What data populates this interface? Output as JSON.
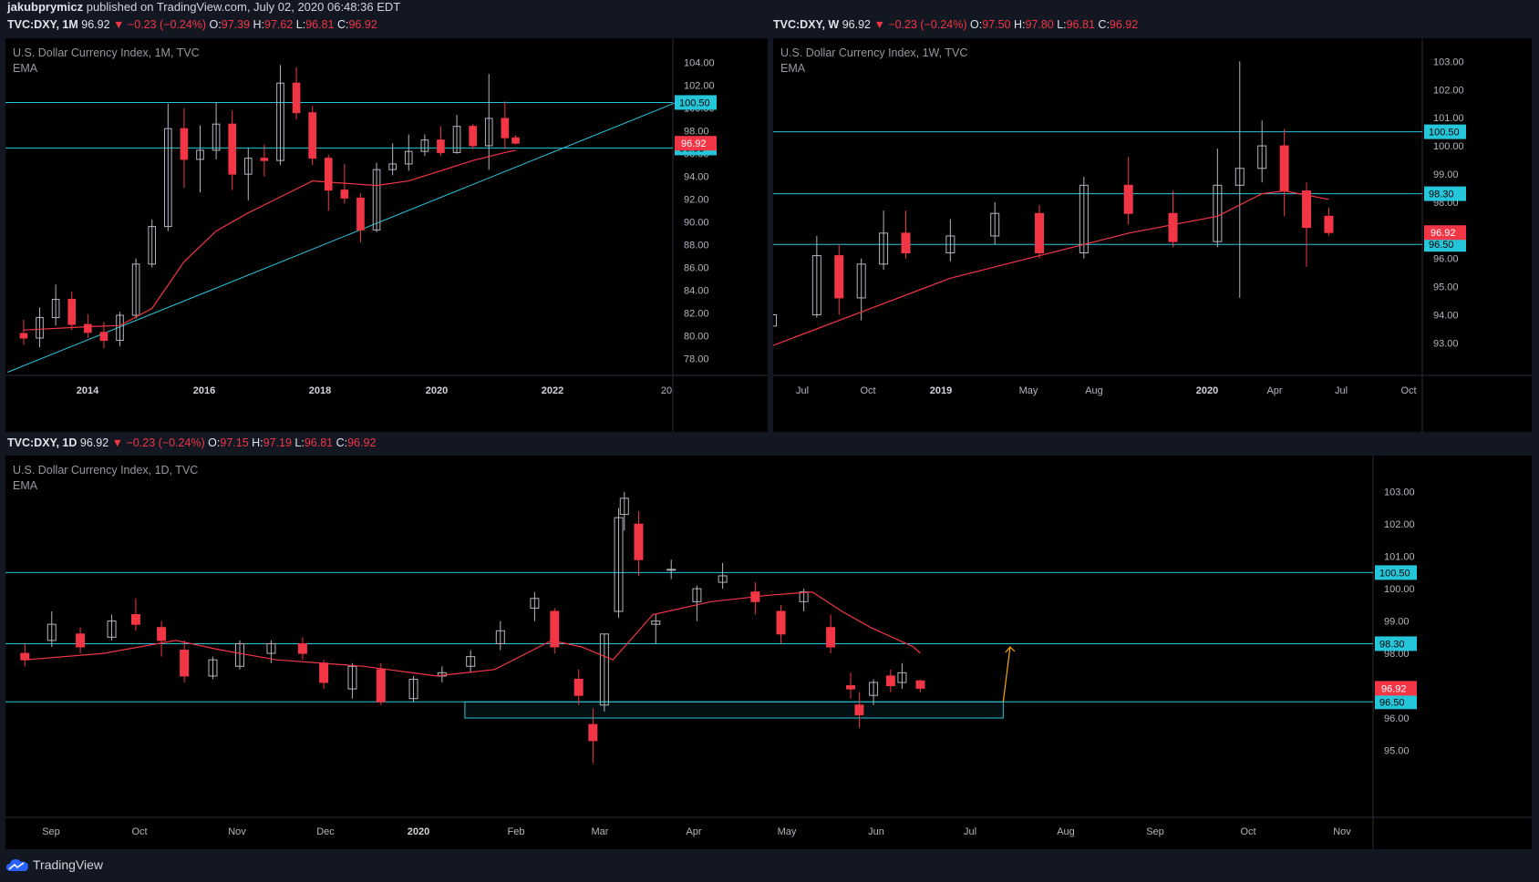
{
  "publish": {
    "author": "jakubprymicz",
    "text": "published on TradingView.com, July 02, 2020 06:48:36 EDT"
  },
  "headers": [
    {
      "sym": "TVC:DXY, 1M",
      "price": "96.92",
      "chg": "−0.23 (−0.24%)",
      "o": "97.39",
      "h": "97.62",
      "l": "96.81",
      "c": "96.92"
    },
    {
      "sym": "TVC:DXY, W",
      "price": "96.92",
      "chg": "−0.23 (−0.24%)",
      "o": "97.50",
      "h": "97.80",
      "l": "96.81",
      "c": "96.92"
    },
    {
      "sym": "TVC:DXY, 1D",
      "price": "96.92",
      "chg": "−0.23 (−0.24%)",
      "o": "97.15",
      "h": "97.19",
      "l": "96.81",
      "c": "96.92"
    }
  ],
  "colors": {
    "bg": "#000000",
    "chrome": "#131722",
    "up": "#b2b5be",
    "down": "#f23645",
    "ema": "#f23645",
    "level": "#26c6da",
    "target_arrow": "#f7a600"
  },
  "chart_data": [
    {
      "type": "candlestick",
      "title": "U.S. Dollar Currency Index, 1M, TVC",
      "indicator": "EMA",
      "yticks": [
        "104.00",
        "102.00",
        "100.00",
        "98.00",
        "96.00",
        "94.00",
        "92.00",
        "90.00",
        "88.00",
        "86.00",
        "84.00",
        "82.00",
        "80.00",
        "78.00"
      ],
      "xticks": [
        "2014",
        "2016",
        "2018",
        "2020",
        "2022",
        "20"
      ],
      "ylim": [
        77,
        105.5
      ],
      "levels": [
        100.5,
        96.5
      ],
      "level_labels": [
        "100.50",
        "96.50"
      ],
      "last_price": "96.92",
      "trendline": {
        "from": [
          "2012-08",
          76.8
        ],
        "to": [
          "2023-01",
          100.5
        ]
      },
      "series": [
        {
          "t": "2012-11",
          "o": 80.2,
          "h": 81.4,
          "l": 79.2,
          "c": 79.8
        },
        {
          "t": "2013-02",
          "o": 79.8,
          "h": 82.5,
          "l": 79.0,
          "c": 81.6
        },
        {
          "t": "2013-05",
          "o": 81.6,
          "h": 84.5,
          "l": 80.9,
          "c": 83.2
        },
        {
          "t": "2013-08",
          "o": 83.2,
          "h": 83.9,
          "l": 80.5,
          "c": 81.0
        },
        {
          "t": "2013-11",
          "o": 81.0,
          "h": 81.9,
          "l": 79.8,
          "c": 80.3
        },
        {
          "t": "2014-02",
          "o": 80.3,
          "h": 81.2,
          "l": 78.9,
          "c": 79.6
        },
        {
          "t": "2014-05",
          "o": 79.6,
          "h": 82.1,
          "l": 79.1,
          "c": 81.8
        },
        {
          "t": "2014-08",
          "o": 81.8,
          "h": 86.8,
          "l": 81.5,
          "c": 86.3
        },
        {
          "t": "2014-11",
          "o": 86.3,
          "h": 90.2,
          "l": 86.0,
          "c": 89.6
        },
        {
          "t": "2015-02",
          "o": 89.6,
          "h": 100.4,
          "l": 89.2,
          "c": 98.2
        },
        {
          "t": "2015-05",
          "o": 98.2,
          "h": 100.0,
          "l": 93.0,
          "c": 95.5
        },
        {
          "t": "2015-08",
          "o": 95.5,
          "h": 98.5,
          "l": 92.6,
          "c": 96.3
        },
        {
          "t": "2015-11",
          "o": 96.3,
          "h": 100.5,
          "l": 95.5,
          "c": 98.6
        },
        {
          "t": "2016-02",
          "o": 98.6,
          "h": 99.8,
          "l": 92.8,
          "c": 94.2
        },
        {
          "t": "2016-05",
          "o": 94.2,
          "h": 96.5,
          "l": 91.9,
          "c": 95.6
        },
        {
          "t": "2016-08",
          "o": 95.6,
          "h": 96.8,
          "l": 94.0,
          "c": 95.4
        },
        {
          "t": "2016-11",
          "o": 95.4,
          "h": 103.8,
          "l": 95.0,
          "c": 102.2
        },
        {
          "t": "2017-02",
          "o": 102.2,
          "h": 103.6,
          "l": 99.0,
          "c": 99.6
        },
        {
          "t": "2017-05",
          "o": 99.6,
          "h": 100.2,
          "l": 95.0,
          "c": 95.6
        },
        {
          "t": "2017-08",
          "o": 95.6,
          "h": 95.9,
          "l": 91.0,
          "c": 92.8
        },
        {
          "t": "2017-11",
          "o": 92.8,
          "h": 95.1,
          "l": 91.6,
          "c": 92.1
        },
        {
          "t": "2018-02",
          "o": 92.1,
          "h": 92.5,
          "l": 88.2,
          "c": 89.3
        },
        {
          "t": "2018-05",
          "o": 89.3,
          "h": 95.2,
          "l": 89.1,
          "c": 94.6
        },
        {
          "t": "2018-08",
          "o": 94.6,
          "h": 96.9,
          "l": 94.1,
          "c": 95.1
        },
        {
          "t": "2018-11",
          "o": 95.1,
          "h": 97.7,
          "l": 94.5,
          "c": 96.2
        },
        {
          "t": "2019-02",
          "o": 96.2,
          "h": 97.7,
          "l": 95.8,
          "c": 97.2
        },
        {
          "t": "2019-05",
          "o": 97.2,
          "h": 98.4,
          "l": 95.8,
          "c": 96.1
        },
        {
          "t": "2019-08",
          "o": 96.1,
          "h": 99.4,
          "l": 96.0,
          "c": 98.4
        },
        {
          "t": "2019-11",
          "o": 98.4,
          "h": 98.6,
          "l": 96.4,
          "c": 96.7
        },
        {
          "t": "2020-02",
          "o": 96.7,
          "h": 103.0,
          "l": 94.6,
          "c": 99.1
        },
        {
          "t": "2020-05",
          "o": 99.1,
          "h": 100.6,
          "l": 96.4,
          "c": 97.4
        },
        {
          "t": "2020-07",
          "o": 97.39,
          "h": 97.62,
          "l": 96.81,
          "c": 96.92
        }
      ],
      "ema": [
        [
          "2012-11",
          80.5
        ],
        [
          "2013-11",
          80.8
        ],
        [
          "2014-05",
          80.9
        ],
        [
          "2014-11",
          82.4
        ],
        [
          "2015-05",
          86.5
        ],
        [
          "2015-11",
          89.2
        ],
        [
          "2016-05",
          90.8
        ],
        [
          "2016-11",
          92.2
        ],
        [
          "2017-05",
          93.6
        ],
        [
          "2017-11",
          93.4
        ],
        [
          "2018-05",
          93.2
        ],
        [
          "2018-11",
          93.6
        ],
        [
          "2019-05",
          94.5
        ],
        [
          "2019-11",
          95.4
        ],
        [
          "2020-05",
          96.1
        ],
        [
          "2020-07",
          96.3
        ]
      ]
    },
    {
      "type": "candlestick",
      "title": "U.S. Dollar Currency Index, 1W, TVC",
      "indicator": "EMA",
      "yticks": [
        "103.00",
        "102.00",
        "101.00",
        "100.00",
        "99.00",
        "98.00",
        "96.00",
        "95.00",
        "94.00",
        "93.00"
      ],
      "xticks": [
        "Jul",
        "Oct",
        "2019",
        "May",
        "Aug",
        "2020",
        "Apr",
        "Jul",
        "Oct"
      ],
      "ylim": [
        92.3,
        103.4
      ],
      "levels": [
        100.5,
        98.3,
        96.5
      ],
      "level_labels": [
        "100.50",
        "98.30",
        "96.50"
      ],
      "last_price": "96.92",
      "series": [
        {
          "t": "2018-06",
          "o": 93.6,
          "h": 94.3,
          "l": 92.9,
          "c": 94.0
        },
        {
          "t": "2018-08",
          "o": 94.0,
          "h": 96.8,
          "l": 93.9,
          "c": 96.1
        },
        {
          "t": "2018-09",
          "o": 96.1,
          "h": 96.5,
          "l": 94.0,
          "c": 94.6
        },
        {
          "t": "2018-10",
          "o": 94.6,
          "h": 96.0,
          "l": 93.8,
          "c": 95.8
        },
        {
          "t": "2018-11",
          "o": 95.8,
          "h": 97.7,
          "l": 95.6,
          "c": 96.9
        },
        {
          "t": "2018-12",
          "o": 96.9,
          "h": 97.7,
          "l": 96.0,
          "c": 96.2
        },
        {
          "t": "2019-02",
          "o": 96.2,
          "h": 97.4,
          "l": 95.9,
          "c": 96.8
        },
        {
          "t": "2019-04",
          "o": 96.8,
          "h": 98.0,
          "l": 96.5,
          "c": 97.6
        },
        {
          "t": "2019-06",
          "o": 97.6,
          "h": 97.9,
          "l": 96.0,
          "c": 96.2
        },
        {
          "t": "2019-08",
          "o": 96.2,
          "h": 98.9,
          "l": 96.0,
          "c": 98.6
        },
        {
          "t": "2019-10",
          "o": 98.6,
          "h": 99.6,
          "l": 97.2,
          "c": 97.6
        },
        {
          "t": "2019-12",
          "o": 97.6,
          "h": 98.4,
          "l": 96.4,
          "c": 96.6
        },
        {
          "t": "2020-02",
          "o": 96.6,
          "h": 99.9,
          "l": 96.4,
          "c": 98.6
        },
        {
          "t": "2020-03",
          "o": 98.6,
          "h": 103.0,
          "l": 94.6,
          "c": 99.2
        },
        {
          "t": "2020-04",
          "o": 99.2,
          "h": 100.9,
          "l": 98.7,
          "c": 100.0
        },
        {
          "t": "2020-05",
          "o": 100.0,
          "h": 100.6,
          "l": 97.5,
          "c": 98.4
        },
        {
          "t": "2020-06",
          "o": 98.4,
          "h": 98.7,
          "l": 95.7,
          "c": 97.1
        },
        {
          "t": "2020-07",
          "o": 97.5,
          "h": 97.8,
          "l": 96.81,
          "c": 96.92
        }
      ],
      "ema": [
        [
          "2018-06",
          92.9
        ],
        [
          "2018-10",
          94.1
        ],
        [
          "2019-02",
          95.3
        ],
        [
          "2019-06",
          96.1
        ],
        [
          "2019-10",
          96.9
        ],
        [
          "2020-02",
          97.5
        ],
        [
          "2020-04",
          98.3
        ],
        [
          "2020-05",
          98.4
        ],
        [
          "2020-07",
          98.1
        ]
      ]
    },
    {
      "type": "candlestick",
      "title": "U.S. Dollar Currency Index, 1D, TVC",
      "indicator": "EMA",
      "yticks": [
        "103.00",
        "102.00",
        "101.00",
        "100.00",
        "99.00",
        "98.00",
        "96.00",
        "95.00"
      ],
      "xticks": [
        "Sep",
        "Oct",
        "Nov",
        "Dec",
        "2020",
        "Feb",
        "Mar",
        "Apr",
        "May",
        "Jun",
        "Jul",
        "Aug",
        "Sep",
        "Oct",
        "Nov"
      ],
      "ylim": [
        94.45,
        103.5
      ],
      "levels": [
        100.5,
        98.3,
        96.5
      ],
      "level_labels": [
        "100.50",
        "98.30",
        "96.50"
      ],
      "last_price": "96.92",
      "zone": {
        "x": [
          "2020-01-25",
          "2020-07-31"
        ],
        "y": [
          96.0,
          96.5
        ]
      },
      "arrow": {
        "from": [
          "2020-07-31",
          96.5
        ],
        "to": [
          "2020-08-03",
          98.2
        ]
      },
      "series": [
        {
          "t": "2019-08-23",
          "o": 98.0,
          "h": 98.3,
          "l": 97.6,
          "c": 97.8
        },
        {
          "t": "2019-09-02",
          "o": 98.4,
          "h": 99.3,
          "l": 98.2,
          "c": 98.9
        },
        {
          "t": "2019-09-12",
          "o": 98.6,
          "h": 98.8,
          "l": 98.0,
          "c": 98.2
        },
        {
          "t": "2019-09-23",
          "o": 98.5,
          "h": 99.2,
          "l": 98.4,
          "c": 99.0
        },
        {
          "t": "2019-10-01",
          "o": 99.2,
          "h": 99.7,
          "l": 98.7,
          "c": 98.9
        },
        {
          "t": "2019-10-10",
          "o": 98.8,
          "h": 99.0,
          "l": 97.9,
          "c": 98.4
        },
        {
          "t": "2019-10-18",
          "o": 98.1,
          "h": 98.4,
          "l": 97.1,
          "c": 97.3
        },
        {
          "t": "2019-10-28",
          "o": 97.3,
          "h": 97.9,
          "l": 97.2,
          "c": 97.8
        },
        {
          "t": "2019-11-07",
          "o": 97.6,
          "h": 98.4,
          "l": 97.5,
          "c": 98.3
        },
        {
          "t": "2019-11-18",
          "o": 98.0,
          "h": 98.4,
          "l": 97.7,
          "c": 98.3
        },
        {
          "t": "2019-11-29",
          "o": 98.3,
          "h": 98.5,
          "l": 97.8,
          "c": 98.0
        },
        {
          "t": "2019-12-06",
          "o": 97.7,
          "h": 97.8,
          "l": 96.9,
          "c": 97.1
        },
        {
          "t": "2019-12-16",
          "o": 96.9,
          "h": 97.7,
          "l": 96.6,
          "c": 97.6
        },
        {
          "t": "2019-12-26",
          "o": 97.5,
          "h": 97.7,
          "l": 96.4,
          "c": 96.5
        },
        {
          "t": "2020-01-07",
          "o": 96.6,
          "h": 97.3,
          "l": 96.5,
          "c": 97.2
        },
        {
          "t": "2020-01-17",
          "o": 97.3,
          "h": 97.6,
          "l": 97.1,
          "c": 97.4
        },
        {
          "t": "2020-01-27",
          "o": 97.6,
          "h": 98.1,
          "l": 97.4,
          "c": 97.9
        },
        {
          "t": "2020-02-07",
          "o": 98.3,
          "h": 99.0,
          "l": 98.1,
          "c": 98.7
        },
        {
          "t": "2020-02-19",
          "o": 99.4,
          "h": 99.9,
          "l": 99.0,
          "c": 99.7
        },
        {
          "t": "2020-02-26",
          "o": 99.3,
          "h": 99.4,
          "l": 98.0,
          "c": 98.2
        },
        {
          "t": "2020-03-04",
          "o": 97.2,
          "h": 97.5,
          "l": 96.4,
          "c": 96.7
        },
        {
          "t": "2020-03-09",
          "o": 95.8,
          "h": 96.3,
          "l": 94.6,
          "c": 95.3
        },
        {
          "t": "2020-03-13",
          "o": 96.4,
          "h": 98.6,
          "l": 96.2,
          "c": 98.6
        },
        {
          "t": "2020-03-18",
          "o": 99.3,
          "h": 102.5,
          "l": 99.1,
          "c": 102.2
        },
        {
          "t": "2020-03-20",
          "o": 102.3,
          "h": 103.0,
          "l": 101.8,
          "c": 102.8
        },
        {
          "t": "2020-03-25",
          "o": 102.0,
          "h": 102.4,
          "l": 100.4,
          "c": 100.9
        },
        {
          "t": "2020-03-31",
          "o": 98.9,
          "h": 99.2,
          "l": 98.3,
          "c": 99.0
        },
        {
          "t": "2020-04-06",
          "o": 100.6,
          "h": 100.9,
          "l": 100.3,
          "c": 100.6
        },
        {
          "t": "2020-04-15",
          "o": 99.6,
          "h": 100.1,
          "l": 99.0,
          "c": 100.0
        },
        {
          "t": "2020-04-24",
          "o": 100.2,
          "h": 100.8,
          "l": 100.0,
          "c": 100.4
        },
        {
          "t": "2020-05-05",
          "o": 99.9,
          "h": 100.2,
          "l": 99.2,
          "c": 99.6
        },
        {
          "t": "2020-05-14",
          "o": 99.3,
          "h": 99.5,
          "l": 98.3,
          "c": 98.6
        },
        {
          "t": "2020-05-22",
          "o": 99.6,
          "h": 100.0,
          "l": 99.3,
          "c": 99.9
        },
        {
          "t": "2020-06-01",
          "o": 98.8,
          "h": 99.2,
          "l": 98.0,
          "c": 98.2
        },
        {
          "t": "2020-06-08",
          "o": 97.0,
          "h": 97.4,
          "l": 96.6,
          "c": 96.9
        },
        {
          "t": "2020-06-11",
          "o": 96.4,
          "h": 96.8,
          "l": 95.7,
          "c": 96.1
        },
        {
          "t": "2020-06-16",
          "o": 96.7,
          "h": 97.2,
          "l": 96.4,
          "c": 97.1
        },
        {
          "t": "2020-06-22",
          "o": 97.3,
          "h": 97.5,
          "l": 96.8,
          "c": 97.0
        },
        {
          "t": "2020-06-26",
          "o": 97.1,
          "h": 97.7,
          "l": 96.9,
          "c": 97.4
        },
        {
          "t": "2020-07-02",
          "o": 97.15,
          "h": 97.19,
          "l": 96.81,
          "c": 96.92
        }
      ],
      "ema": [
        [
          "2019-08-23",
          97.8
        ],
        [
          "2019-09-20",
          98.0
        ],
        [
          "2019-10-15",
          98.4
        ],
        [
          "2019-10-31",
          98.1
        ],
        [
          "2019-11-20",
          97.8
        ],
        [
          "2019-12-20",
          97.6
        ],
        [
          "2020-01-15",
          97.3
        ],
        [
          "2020-02-05",
          97.5
        ],
        [
          "2020-02-25",
          98.4
        ],
        [
          "2020-03-05",
          98.2
        ],
        [
          "2020-03-16",
          97.8
        ],
        [
          "2020-03-30",
          99.2
        ],
        [
          "2020-04-20",
          99.6
        ],
        [
          "2020-05-10",
          99.8
        ],
        [
          "2020-05-25",
          99.9
        ],
        [
          "2020-06-05",
          99.3
        ],
        [
          "2020-06-15",
          98.8
        ],
        [
          "2020-06-30",
          98.2
        ],
        [
          "2020-07-02",
          98.0
        ]
      ]
    }
  ],
  "footer": {
    "brand": "TradingView"
  }
}
